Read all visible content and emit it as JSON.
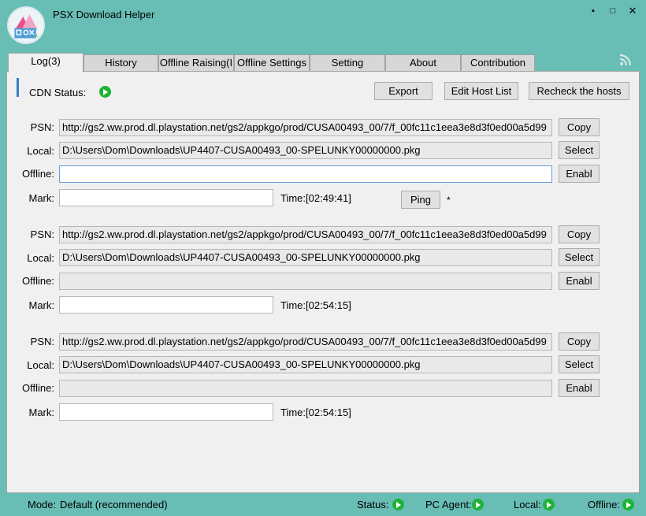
{
  "app": {
    "title": "PSX Download Helper"
  },
  "window_controls": {
    "minimize": "▪",
    "maximize": "□",
    "close": "✕"
  },
  "tabs": [
    {
      "label": "Log(3)"
    },
    {
      "label": "History"
    },
    {
      "label": "Offline Raising(I"
    },
    {
      "label": "Offline Settings"
    },
    {
      "label": "Setting"
    },
    {
      "label": "About"
    },
    {
      "label": "Contribution"
    }
  ],
  "toolbar": {
    "cdn_label": "CDN Status:",
    "export": "Export",
    "edit_host": "Edit Host List",
    "recheck": "Recheck the hosts"
  },
  "labels": {
    "psn": "PSN:",
    "local": "Local:",
    "offline": "Offline:",
    "mark": "Mark:"
  },
  "buttons": {
    "copy": "Copy",
    "select": "Select",
    "enable": "Enabl",
    "ping": "Ping"
  },
  "ping_marker": "*",
  "entries": [
    {
      "psn": "http://gs2.ww.prod.dl.playstation.net/gs2/appkgo/prod/CUSA00493_00/7/f_00fc11c1eea3e8d3f0ed00a5d99",
      "local": "D:\\Users\\Dom\\Downloads\\UP4407-CUSA00493_00-SPELUNKY00000000.pkg",
      "offline": "",
      "mark": "",
      "time": "Time:[02:49:41]"
    },
    {
      "psn": "http://gs2.ww.prod.dl.playstation.net/gs2/appkgo/prod/CUSA00493_00/7/f_00fc11c1eea3e8d3f0ed00a5d99",
      "local": "D:\\Users\\Dom\\Downloads\\UP4407-CUSA00493_00-SPELUNKY00000000.pkg",
      "offline": "",
      "mark": "",
      "time": "Time:[02:54:15]"
    },
    {
      "psn": "http://gs2.ww.prod.dl.playstation.net/gs2/appkgo/prod/CUSA00493_00/7/f_00fc11c1eea3e8d3f0ed00a5d99",
      "local": "D:\\Users\\Dom\\Downloads\\UP4407-CUSA00493_00-SPELUNKY00000000.pkg",
      "offline": "",
      "mark": "",
      "time": "Time:[02:54:15]"
    }
  ],
  "statusbar": {
    "mode_label": "Mode:",
    "mode_value": "Default (recommended)",
    "status": "Status:",
    "pc_agent": "PC Agent:",
    "local": "Local:",
    "offline": "Offline:"
  },
  "colors": {
    "window_bg": "#68bdb5",
    "panel_bg": "#f0f0f0",
    "status_green": "#1fb336",
    "accent": "#3b7cc4"
  }
}
